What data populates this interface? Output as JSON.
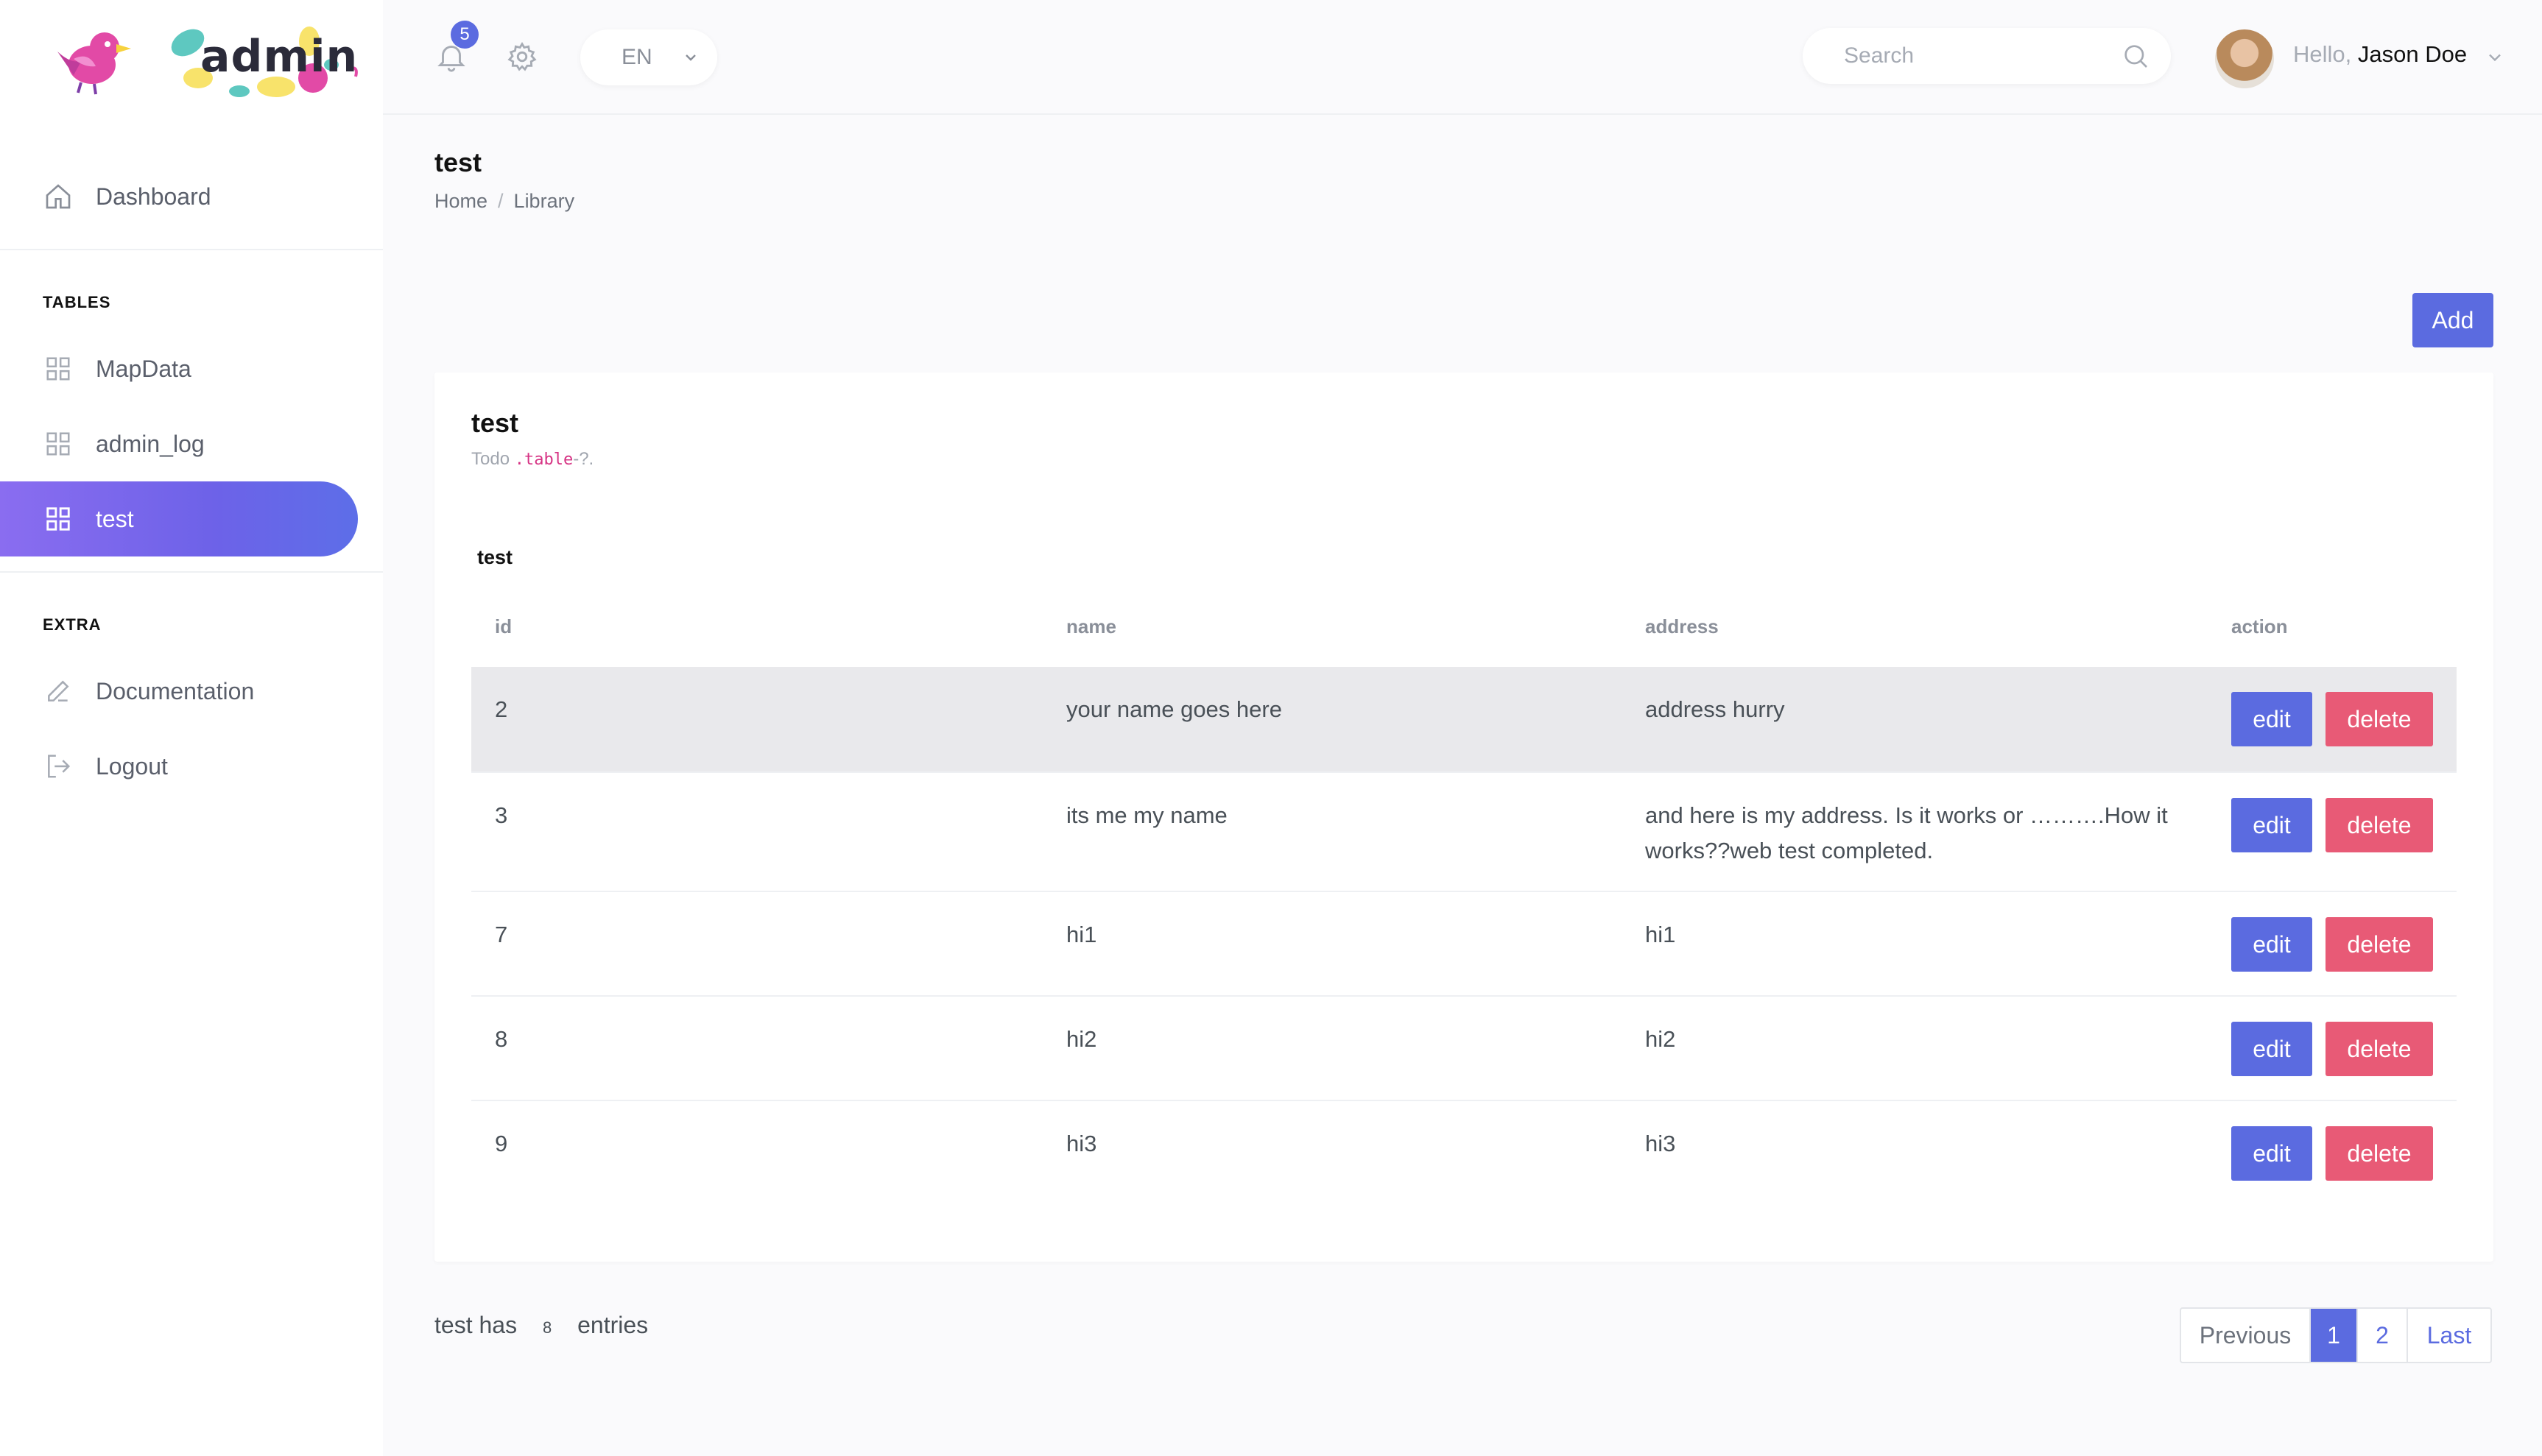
{
  "brand": {
    "name": "admin"
  },
  "sidebar": {
    "items": [
      {
        "label": "Dashboard",
        "icon": "home-icon"
      },
      {
        "label": "MapData",
        "icon": "grid-icon"
      },
      {
        "label": "admin_log",
        "icon": "grid-icon"
      },
      {
        "label": "test",
        "icon": "grid-icon",
        "active": true
      },
      {
        "label": "Documentation",
        "icon": "pencil-icon"
      },
      {
        "label": "Logout",
        "icon": "logout-icon"
      }
    ],
    "headings": {
      "tables": "TABLES",
      "extra": "EXTRA"
    }
  },
  "header": {
    "notification_count": "5",
    "language": "EN",
    "search_placeholder": "Search",
    "greeting": "Hello,",
    "user_name": "Jason Doe"
  },
  "page": {
    "title": "test",
    "breadcrumb": [
      "Home",
      "Library"
    ],
    "add_label": "Add"
  },
  "card": {
    "title": "test",
    "subtitle_prefix": "Todo",
    "subtitle_code": ".table",
    "subtitle_suffix": "-?.",
    "table_caption": "test",
    "columns": [
      "id",
      "name",
      "address",
      "action"
    ],
    "rows": [
      {
        "id": "2",
        "name": "your name goes here",
        "address": "address hurry"
      },
      {
        "id": "3",
        "name": "its me my name",
        "address": "and here is my address. Is it works or ……….How it works??web test completed."
      },
      {
        "id": "7",
        "name": "hi1",
        "address": "hi1"
      },
      {
        "id": "8",
        "name": "hi2",
        "address": "hi2"
      },
      {
        "id": "9",
        "name": "hi3",
        "address": "hi3"
      }
    ],
    "edit_label": "edit",
    "delete_label": "delete"
  },
  "footer": {
    "entries_prefix": "test has",
    "entries_count": "8",
    "entries_suffix": "entries",
    "pagination": {
      "previous": "Previous",
      "pages": [
        "1",
        "2"
      ],
      "current": "1",
      "last": "Last"
    }
  },
  "colors": {
    "accent": "#5b6be0",
    "danger": "#e85a76",
    "sidebar_active": "#7a66ec"
  }
}
